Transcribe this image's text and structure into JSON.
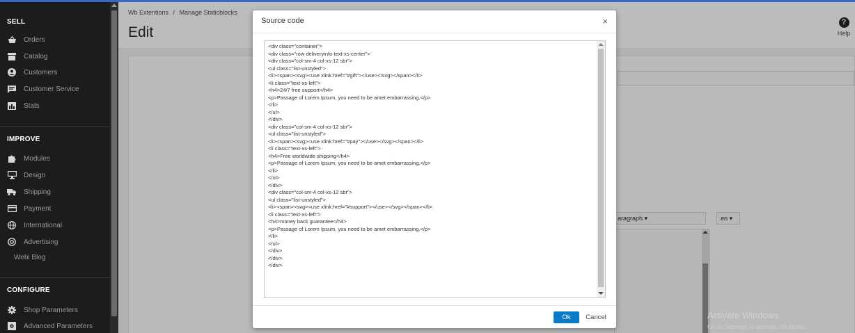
{
  "sidebar": {
    "sections": {
      "sell": "SELL",
      "improve": "IMPROVE",
      "configure": "CONFIGURE"
    },
    "items": [
      {
        "label": "Orders",
        "icon": "basket-icon"
      },
      {
        "label": "Catalog",
        "icon": "catalog-icon"
      },
      {
        "label": "Customers",
        "icon": "customer-icon"
      },
      {
        "label": "Customer Service",
        "icon": "chat-icon"
      },
      {
        "label": "Stats",
        "icon": "stats-icon"
      },
      {
        "label": "Modules",
        "icon": "puzzle-icon"
      },
      {
        "label": "Design",
        "icon": "monitor-icon"
      },
      {
        "label": "Shipping",
        "icon": "truck-icon"
      },
      {
        "label": "Payment",
        "icon": "card-icon"
      },
      {
        "label": "International",
        "icon": "globe-icon"
      },
      {
        "label": "Advertising",
        "icon": "at-icon"
      },
      {
        "label": "Webi Blog",
        "icon": ""
      },
      {
        "label": "Shop Parameters",
        "icon": "gear-icon"
      },
      {
        "label": "Advanced Parameters",
        "icon": "advanced-icon"
      }
    ]
  },
  "header": {
    "breadcrumb_root": "Wb Extentions",
    "breadcrumb_sep": "/",
    "breadcrumb_current": "Manage Staticblocks",
    "title": "Edit",
    "help_label": "Help",
    "help_glyph": "?"
  },
  "editor": {
    "format_select": "aragraph ▾",
    "language_select": "en ▾"
  },
  "watermark": {
    "title": "Activate Windows",
    "subtitle": "Go to Settings to activate Windows."
  },
  "modal": {
    "title": "Source code",
    "close_glyph": "×",
    "ok_label": "Ok",
    "cancel_label": "Cancel",
    "code_lines": [
      "<div class=\"container\">",
      "<div class=\"row deliveryinfo text-xs-center\">",
      "<div class=\"col-sm-4 col-xs-12 sbr\">",
      "<ul class=\"list-unstyled\">",
      "<li><span><svg><use xlink:href=\"#gift\"></use></svg></span></li>",
      "<li class=\"text-xs-left\">",
      "<h4>24/7 free support</h4>",
      "<p>Passage of Lorem Ipsum, you need to be amet embarrassing.</p>",
      "</li>",
      "</ul>",
      "</div>",
      "<div class=\"col-sm-4 col-xs-12 sbr\">",
      "<ul class=\"list-unstyled\">",
      "<li><span><svg><use xlink:href=\"#pay\"></use></svg></span></li>",
      "<li class=\"text-xs-left\">",
      "<h4>Free worldwide shipping</h4>",
      "<p>Passage of Lorem Ipsum, you need to be amet embarrassing.</p>",
      "</li>",
      "</ul>",
      "</div>",
      "<div class=\"col-sm-4 col-xs-12 sbr\">",
      "<ul class=\"list-unstyled\">",
      "<li><span><svg><use xlink:href=\"#support\"></use></svg></span></li>",
      "<li class=\"text-xs-left\">",
      "<h4>money back guarantee</h4>",
      "<p>Passage of Lorem Ipsum, you need to be amet embarrassing.</p>",
      "</li>",
      "</ul>",
      "</div>",
      "</div>",
      "</div>"
    ]
  },
  "colors": {
    "accent": "#0a7cc7",
    "top_line": "#3b66c4",
    "sidebar_bg": "#1c1c1c"
  }
}
